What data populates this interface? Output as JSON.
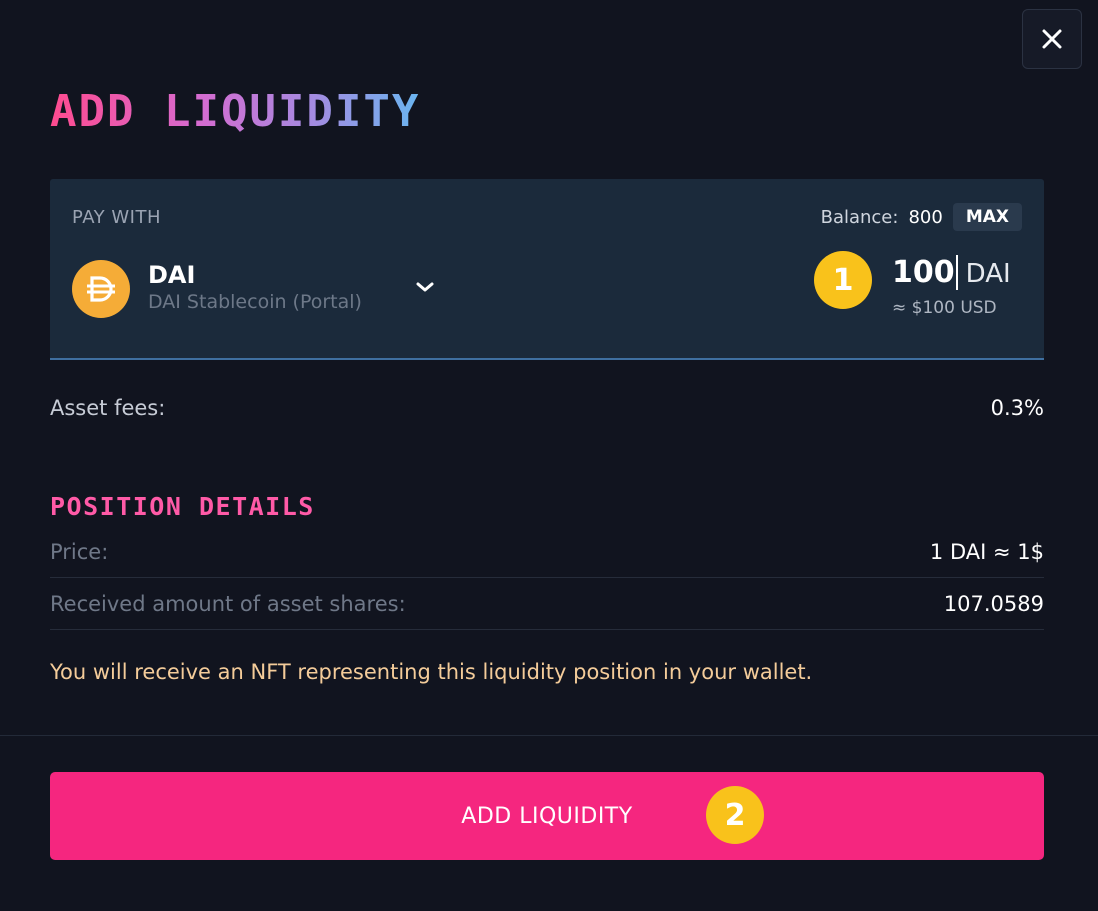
{
  "modal": {
    "title": "ADD LIQUIDITY",
    "close_icon": "close-icon"
  },
  "pay": {
    "label": "PAY WITH",
    "balance_label": "Balance:",
    "balance_value": "800",
    "max_label": "MAX",
    "token": {
      "symbol": "DAI",
      "name": "DAI Stablecoin (Portal)",
      "icon": "dai-token-icon",
      "icon_color": "#f5ac37"
    },
    "amount": "100",
    "amount_unit": "DAI",
    "usd_estimate": "≈ $100 USD"
  },
  "fees": {
    "label": "Asset fees:",
    "value": "0.3%"
  },
  "position": {
    "title": "POSITION DETAILS",
    "rows": [
      {
        "label": "Price:",
        "value": "1 DAI ≈ 1$"
      },
      {
        "label": "Received amount of asset shares:",
        "value": "107.0589"
      }
    ],
    "note": "You will receive an NFT representing this liquidity position in your wallet."
  },
  "annotations": {
    "step1": "1",
    "step2": "2",
    "badge_color": "#f9c21b"
  },
  "actions": {
    "add_liquidity_label": "ADD LIQUIDITY",
    "button_color": "#f5267f"
  }
}
